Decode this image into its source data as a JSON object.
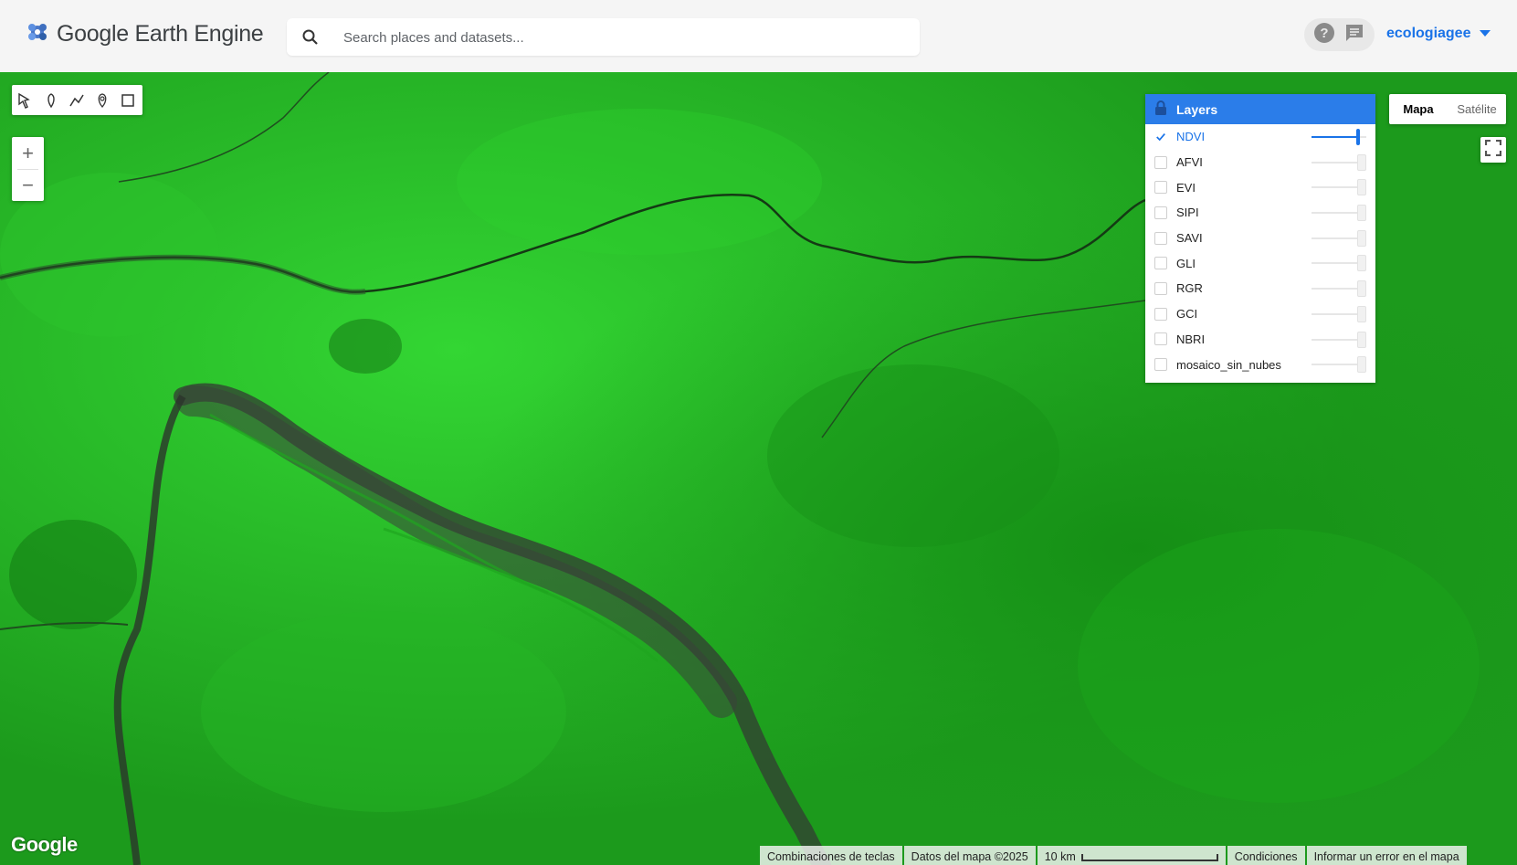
{
  "header": {
    "app_title": "Google Earth Engine",
    "search_placeholder": "Search places and datasets...",
    "account_name": "ecologiagee"
  },
  "map": {
    "zoom_in": "+",
    "zoom_out": "−",
    "layers_title": "Layers",
    "layers": [
      {
        "name": "NDVI",
        "checked": true,
        "opacity": 1.0
      },
      {
        "name": "AFVI",
        "checked": false,
        "opacity": 1.0
      },
      {
        "name": "EVI",
        "checked": false,
        "opacity": 1.0
      },
      {
        "name": "SIPI",
        "checked": false,
        "opacity": 1.0
      },
      {
        "name": "SAVI",
        "checked": false,
        "opacity": 1.0
      },
      {
        "name": "GLI",
        "checked": false,
        "opacity": 1.0
      },
      {
        "name": "RGR",
        "checked": false,
        "opacity": 1.0
      },
      {
        "name": "GCI",
        "checked": false,
        "opacity": 1.0
      },
      {
        "name": "NBRI",
        "checked": false,
        "opacity": 1.0
      },
      {
        "name": "mosaico_sin_nubes",
        "checked": false,
        "opacity": 1.0
      }
    ],
    "map_type_options": [
      "Mapa",
      "Satélite"
    ],
    "map_type_selected": "Mapa",
    "google_logo": "Google"
  },
  "footer": {
    "shortcuts": "Combinaciones de teclas",
    "map_data": "Datos del mapa ©2025",
    "scale": "10 km",
    "terms": "Condiciones",
    "report": "Informar un error en el mapa"
  },
  "colors": {
    "accent": "#1a73e8",
    "layers_header": "#2b7de9",
    "map_green": "#1fa51f"
  }
}
